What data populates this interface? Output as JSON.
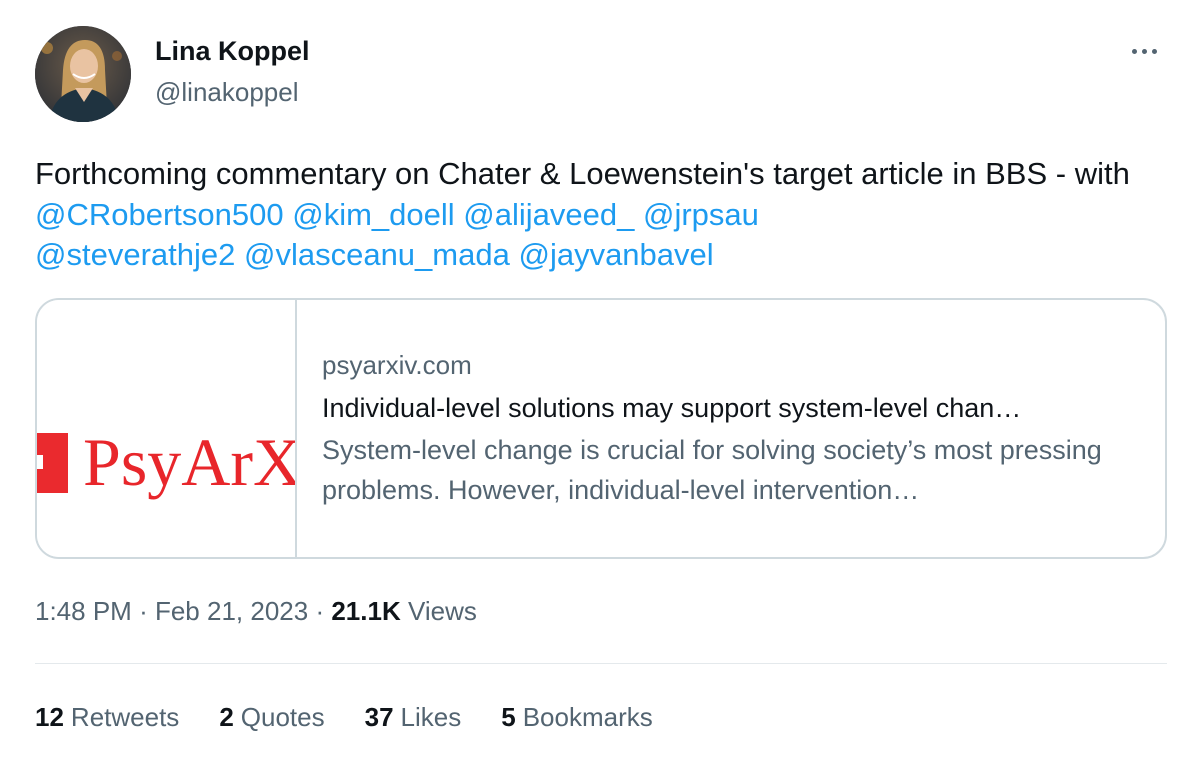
{
  "author": {
    "name": "Lina Koppel",
    "handle": "@linakoppel"
  },
  "tweet": {
    "text_parts": {
      "intro": "Forthcoming commentary on Chater & Loewenstein's target article in BBS - with "
    },
    "mentions": [
      "@CRobertson500",
      "@kim_doell",
      "@alijaveed_",
      "@jrpsau",
      "@steverathje2",
      "@vlasceanu_mada",
      "@jayvanbavel"
    ]
  },
  "link_card": {
    "thumbnail_text": "PsyArX",
    "domain": "psyarxiv.com",
    "title": "Individual-level solutions may support system-level chan…",
    "description": "System-level change is crucial for solving society’s most pressing problems. However, individual-level intervention…"
  },
  "meta": {
    "time": "1:48 PM",
    "separator": "·",
    "date": "Feb 21, 2023",
    "views_count": "21.1K",
    "views_label": "Views"
  },
  "stats": {
    "retweets": {
      "count": "12",
      "label": "Retweets"
    },
    "quotes": {
      "count": "2",
      "label": "Quotes"
    },
    "likes": {
      "count": "37",
      "label": "Likes"
    },
    "bookmarks": {
      "count": "5",
      "label": "Bookmarks"
    }
  },
  "colors": {
    "link": "#1d9bf0",
    "secondary_text": "#536471",
    "primary_text": "#0f1419",
    "psyarxiv_red": "#e8262b"
  },
  "icons": {
    "more": "more-horizontal-icon"
  }
}
